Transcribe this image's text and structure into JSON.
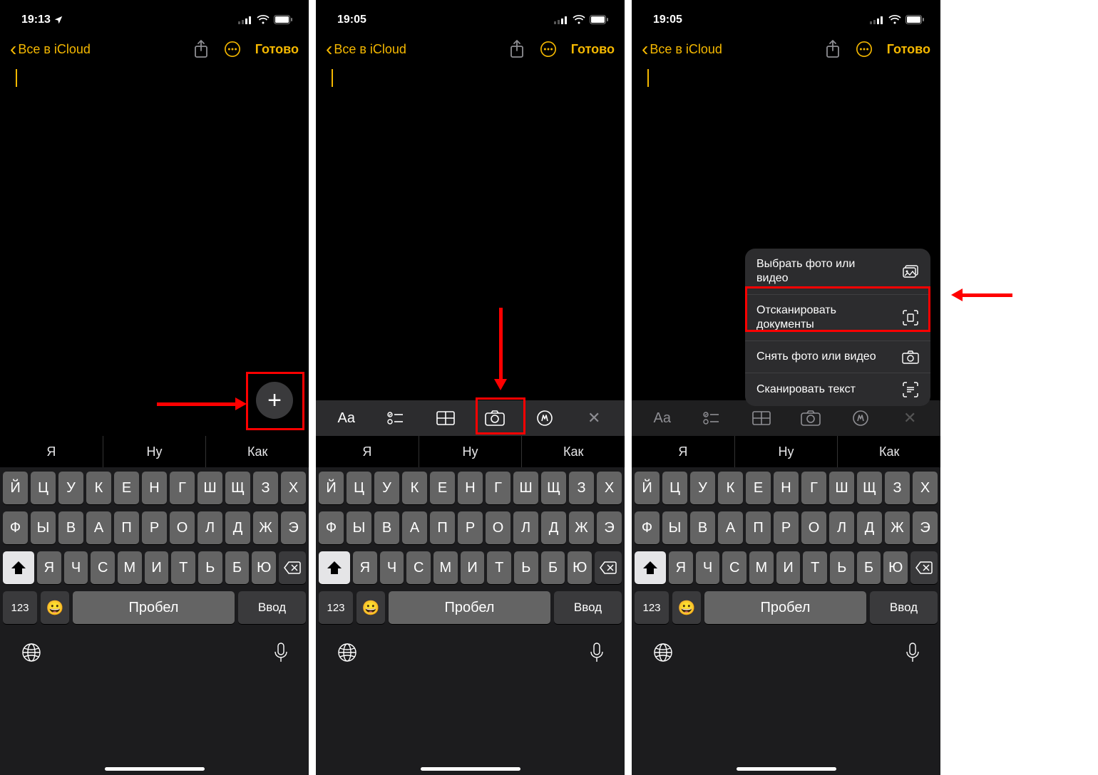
{
  "status": {
    "time1": "19:13",
    "time2": "19:05",
    "time3": "19:05"
  },
  "nav": {
    "back": "Все в iCloud",
    "done": "Готово"
  },
  "suggestions": [
    "Я",
    "Ну",
    "Как"
  ],
  "keyboard": {
    "row1": [
      "Й",
      "Ц",
      "У",
      "К",
      "Е",
      "Н",
      "Г",
      "Ш",
      "Щ",
      "З",
      "Х"
    ],
    "row2": [
      "Ф",
      "Ы",
      "В",
      "А",
      "П",
      "Р",
      "О",
      "Л",
      "Д",
      "Ж",
      "Э"
    ],
    "row3": [
      "Я",
      "Ч",
      "С",
      "М",
      "И",
      "Т",
      "Ь",
      "Б",
      "Ю"
    ],
    "num": "123",
    "space": "Пробел",
    "enter": "Ввод"
  },
  "menu": {
    "item1": "Выбрать фото или видео",
    "item2": "Отсканировать документы",
    "item3": "Снять фото или видео",
    "item4": "Сканировать текст"
  }
}
